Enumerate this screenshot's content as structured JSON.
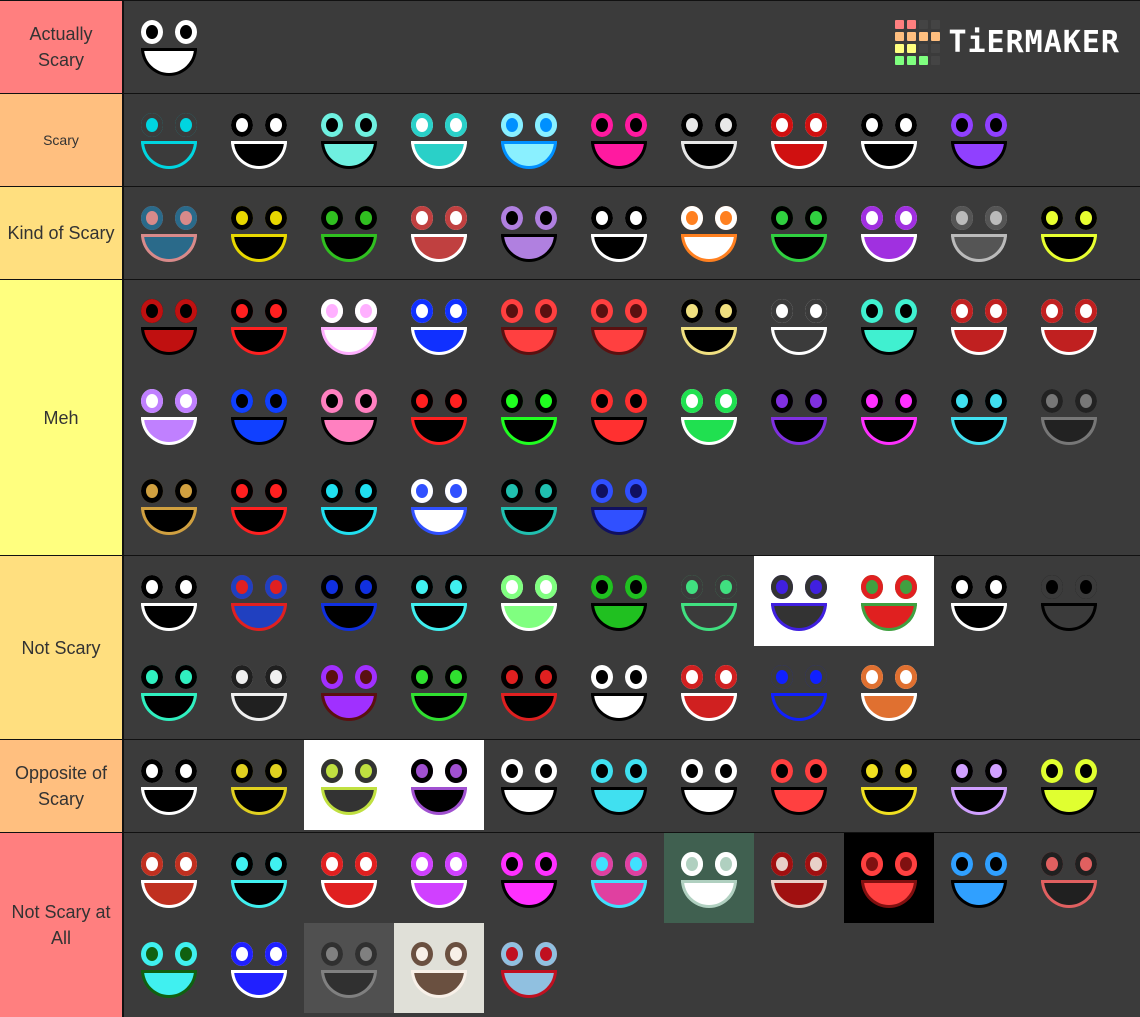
{
  "logo": {
    "text": "TiERMAKER",
    "grid_colors": [
      "#ff7f7f",
      "#ff7f7f",
      "#444444",
      "#444444",
      "#ffbf7f",
      "#ffbf7f",
      "#ffbf7f",
      "#ffbf7f",
      "#ffff7f",
      "#ffff7f",
      "#444444",
      "#444444",
      "#7fff7f",
      "#7fff7f",
      "#7fff7f",
      "#444444"
    ]
  },
  "tiers": [
    {
      "label": "Actually Scary",
      "color": "#ff7f7f",
      "items": [
        {
          "name": "black-figure",
          "bg": "#3b3b3b",
          "fg": "#000000",
          "accent": "#ffffff"
        }
      ]
    },
    {
      "label": "Scary",
      "color": "#ffbf7f",
      "items": [
        {
          "name": "cyan-smile",
          "bg": "#3b3b3b",
          "fg": "#00d5e0",
          "accent": "#3b3b3b"
        },
        {
          "name": "pixel-grin",
          "bg": "#3b3b3b",
          "fg": "#ffffff",
          "accent": "#000000"
        },
        {
          "name": "black-teal-grin",
          "bg": "#3b3b3b",
          "fg": "#000000",
          "accent": "#6ff0e0"
        },
        {
          "name": "teal-eyes-grin",
          "bg": "#3b3b3b",
          "fg": "#ffffff",
          "accent": "#2ad0c8"
        },
        {
          "name": "blue-glow-face",
          "bg": "#3b3b3b",
          "fg": "#0090ff",
          "accent": "#8af0ff"
        },
        {
          "name": "magenta-mouth",
          "bg": "#3b3b3b",
          "fg": "#000000",
          "accent": "#ff1aa0"
        },
        {
          "name": "white-scribble-face",
          "bg": "#3b3b3b",
          "fg": "#e8e8e8",
          "accent": "#000000"
        },
        {
          "name": "red-white-grin",
          "bg": "#3b3b3b",
          "fg": "#ffffff",
          "accent": "#d01010"
        },
        {
          "name": "pixel-grin-2",
          "bg": "#3b3b3b",
          "fg": "#ffffff",
          "accent": "#000000"
        },
        {
          "name": "purple-fang-mouth",
          "bg": "#3b3b3b",
          "fg": "#000000",
          "accent": "#9040ff"
        }
      ]
    },
    {
      "label": "Kind of Scary",
      "color": "#ffdf7f",
      "items": [
        {
          "name": "realistic-eyeball",
          "bg": "#3b3b3b",
          "fg": "#d88a8a",
          "accent": "#2a6a8a"
        },
        {
          "name": "yellow-crescents",
          "bg": "#3b3b3b",
          "fg": "#e8d800",
          "accent": "#000000"
        },
        {
          "name": "green-blades",
          "bg": "#3b3b3b",
          "fg": "#30c020",
          "accent": "#000000"
        },
        {
          "name": "lips-grin",
          "bg": "#3b3b3b",
          "fg": "#ffffff",
          "accent": "#c04040"
        },
        {
          "name": "purple-grin",
          "bg": "#3b3b3b",
          "fg": "#000000",
          "accent": "#b080e0"
        },
        {
          "name": "white-stripes",
          "bg": "#3b3b3b",
          "fg": "#ffffff",
          "accent": "#000000"
        },
        {
          "name": "orange-beak",
          "bg": "#3b3b3b",
          "fg": "#ff8020",
          "accent": "#ffffff"
        },
        {
          "name": "green-frown",
          "bg": "#3b3b3b",
          "fg": "#30d040",
          "accent": "#000000"
        },
        {
          "name": "spiral-eyes",
          "bg": "#3b3b3b",
          "fg": "#ffffff",
          "accent": "#a030e0"
        },
        {
          "name": "gray-ghost",
          "bg": "#3b3b3b",
          "fg": "#bbbbbb",
          "accent": "#555555"
        },
        {
          "name": "yellow-drop",
          "bg": "#3b3b3b",
          "fg": "#e8ff30",
          "accent": "#000000"
        }
      ]
    },
    {
      "label": "Meh",
      "color": "#ffff7f",
      "items": [
        {
          "name": "red-eyes-mossy",
          "bg": "#3b3b3b",
          "fg": "#000000",
          "accent": "#c01010"
        },
        {
          "name": "red-heart-mouth",
          "bg": "#3b3b3b",
          "fg": "#ff2020",
          "accent": "#000000"
        },
        {
          "name": "pink-eyes",
          "bg": "#3b3b3b",
          "fg": "#ffb0ff",
          "accent": "#ffffff"
        },
        {
          "name": "blue-outline-eyes",
          "bg": "#3b3b3b",
          "fg": "#ffffff",
          "accent": "#1030ff"
        },
        {
          "name": "red-shadow-face",
          "bg": "#3b3b3b",
          "fg": "#5a1010",
          "accent": "#ff4040"
        },
        {
          "name": "red-shadow-face-2",
          "bg": "#3b3b3b",
          "fg": "#5a1010",
          "accent": "#ff4040"
        },
        {
          "name": "yellow-mushroom",
          "bg": "#3b3b3b",
          "fg": "#f0e080",
          "accent": "#000000"
        },
        {
          "name": "white-scribble-smile",
          "bg": "#3b3b3b",
          "fg": "#ffffff",
          "accent": "#3b3b3b"
        },
        {
          "name": "teal-eye-grin",
          "bg": "#3b3b3b",
          "fg": "#000000",
          "accent": "#40f0d0"
        },
        {
          "name": "red-gum-smile",
          "bg": "#3b3b3b",
          "fg": "#ffffff",
          "accent": "#c02020"
        },
        {
          "name": "cyclops-grin",
          "bg": "#3b3b3b",
          "fg": "#ffffff",
          "accent": "#c02020"
        },
        {
          "name": "purple-eyes-frown",
          "bg": "#3b3b3b",
          "fg": "#ffffff",
          "accent": "#c080ff"
        },
        {
          "name": "blue-glint-grin",
          "bg": "#3b3b3b",
          "fg": "#000000",
          "accent": "#1040ff"
        },
        {
          "name": "pink-tongue",
          "bg": "#3b3b3b",
          "fg": "#000000",
          "accent": "#ff80c0"
        },
        {
          "name": "red-skull",
          "bg": "#3b3b3b",
          "fg": "#ff2020",
          "accent": "#000000"
        },
        {
          "name": "green-blocks",
          "bg": "#3b3b3b",
          "fg": "#20ff20",
          "accent": "#000000"
        },
        {
          "name": "red-glow-grin",
          "bg": "#3b3b3b",
          "fg": "#000000",
          "accent": "#ff3030"
        },
        {
          "name": "green-frown-blob",
          "bg": "#3b3b3b",
          "fg": "#ffffff",
          "accent": "#20e050"
        },
        {
          "name": "purple-ring-eyes",
          "bg": "#3b3b3b",
          "fg": "#8030e0",
          "accent": "#000000"
        },
        {
          "name": "magenta-eyes-grin",
          "bg": "#3b3b3b",
          "fg": "#ff30ff",
          "accent": "#000000"
        },
        {
          "name": "cyan-frown",
          "bg": "#3b3b3b",
          "fg": "#40e0f0",
          "accent": "#000000"
        },
        {
          "name": "glitch-static",
          "bg": "#3b3b3b",
          "fg": "#777777",
          "accent": "#222222"
        },
        {
          "name": "gold-ring-eyes",
          "bg": "#3b3b3b",
          "fg": "#d0a040",
          "accent": "#000000"
        },
        {
          "name": "red-pixel-face",
          "bg": "#3b3b3b",
          "fg": "#ff2020",
          "accent": "#000000"
        },
        {
          "name": "cyan-pixel-face",
          "bg": "#3b3b3b",
          "fg": "#20e0f0",
          "accent": "#000000"
        },
        {
          "name": "blue-slash",
          "bg": "#3b3b3b",
          "fg": "#3050ff",
          "accent": "#ffffff"
        },
        {
          "name": "teal-tree",
          "bg": "#3b3b3b",
          "fg": "#20c0b0",
          "accent": "#000000"
        },
        {
          "name": "dark-blue-face",
          "bg": "#3b3b3b",
          "fg": "#101060",
          "accent": "#3050ff"
        }
      ]
    },
    {
      "label": "Not Scary",
      "color": "#ffdf7f",
      "items": [
        {
          "name": "trollface",
          "bg": "#3b3b3b",
          "fg": "#ffffff",
          "accent": "#000000"
        },
        {
          "name": "mario",
          "bg": "#3b3b3b",
          "fg": "#e02020",
          "accent": "#2040c0"
        },
        {
          "name": "blue-frown-eyes",
          "bg": "#3b3b3b",
          "fg": "#1030e0",
          "accent": "#000000"
        },
        {
          "name": "cyan-mouth-eyes",
          "bg": "#3b3b3b",
          "fg": "#40f0f0",
          "accent": "#000000"
        },
        {
          "name": "green-white-eyes",
          "bg": "#3b3b3b",
          "fg": "#ffffff",
          "accent": "#80ff80"
        },
        {
          "name": "dark-green-eyes",
          "bg": "#3b3b3b",
          "fg": "#000000",
          "accent": "#20c020"
        },
        {
          "name": "green-lips",
          "bg": "#3b3b3b",
          "fg": "#40e080",
          "accent": "#3b3b3b"
        },
        {
          "name": "scribble-blue-mouth",
          "bg": "#ffffff",
          "fg": "#4020e0",
          "accent": "#333333"
        },
        {
          "name": "scribble-green-grin",
          "bg": "#ffffff",
          "fg": "#40a040",
          "accent": "#e02020"
        },
        {
          "name": "white-eyes-mask",
          "bg": "#3b3b3b",
          "fg": "#ffffff",
          "accent": "#000000"
        },
        {
          "name": "sad-outline-face",
          "bg": "#3b3b3b",
          "fg": "#000000",
          "accent": "#3b3b3b"
        },
        {
          "name": "teal-v-face",
          "bg": "#3b3b3b",
          "fg": "#30f0c0",
          "accent": "#000000"
        },
        {
          "name": "eyeball-cluster",
          "bg": "#3b3b3b",
          "fg": "#f0f0f0",
          "accent": "#202020"
        },
        {
          "name": "purple-bandage",
          "bg": "#3b3b3b",
          "fg": "#5a1010",
          "accent": "#a030ff"
        },
        {
          "name": "green-eyes-smile",
          "bg": "#3b3b3b",
          "fg": "#30e030",
          "accent": "#000000"
        },
        {
          "name": "red-eye-grin",
          "bg": "#3b3b3b",
          "fg": "#e02020",
          "accent": "#000000"
        },
        {
          "name": "black-eyes-teeth",
          "bg": "#3b3b3b",
          "fg": "#000000",
          "accent": "#ffffff"
        },
        {
          "name": "red-white-eyes-grin",
          "bg": "#3b3b3b",
          "fg": "#ffffff",
          "accent": "#d02020"
        },
        {
          "name": "blue-smile",
          "bg": "#3b3b3b",
          "fg": "#1020ff",
          "accent": "#3b3b3b"
        },
        {
          "name": "orange-egg",
          "bg": "#3b3b3b",
          "fg": "#ffffff",
          "accent": "#e07030"
        }
      ]
    },
    {
      "label": "Opposite of Scary",
      "color": "#ffbf7f",
      "items": [
        {
          "name": "trollface-2",
          "bg": "#3b3b3b",
          "fg": "#ffffff",
          "accent": "#000000"
        },
        {
          "name": "yellow-smirk",
          "bg": "#3b3b3b",
          "fg": "#e0d020",
          "accent": "#000000"
        },
        {
          "name": "scribble-yellow-mouth",
          "bg": "#ffffff",
          "fg": "#c0e040",
          "accent": "#333333"
        },
        {
          "name": "purple-ghost-grin",
          "bg": "#ffffff",
          "fg": "#a050d0",
          "accent": "#000000"
        },
        {
          "name": "blue-eye-grin",
          "bg": "#3b3b3b",
          "fg": "#000000",
          "accent": "#ffffff"
        },
        {
          "name": "cyan-frown-eyes",
          "bg": "#3b3b3b",
          "fg": "#000000",
          "accent": "#40e0f0"
        },
        {
          "name": "purple-tooth-grin",
          "bg": "#3b3b3b",
          "fg": "#000000",
          "accent": "#ffffff"
        },
        {
          "name": "red-eye-smile",
          "bg": "#3b3b3b",
          "fg": "#000000",
          "accent": "#ff4040"
        },
        {
          "name": "yellow-beak",
          "bg": "#3b3b3b",
          "fg": "#f0e020",
          "accent": "#000000"
        },
        {
          "name": "lavender-blob",
          "bg": "#3b3b3b",
          "fg": "#d0a0ff",
          "accent": "#000000"
        },
        {
          "name": "green-slits",
          "bg": "#3b3b3b",
          "fg": "#000000",
          "accent": "#e0ff30"
        }
      ]
    },
    {
      "label": "Not Scary at All",
      "color": "#ff7f7f",
      "items": [
        {
          "name": "red-lip-grin",
          "bg": "#3b3b3b",
          "fg": "#ffffff",
          "accent": "#c03020"
        },
        {
          "name": "cyan-v-mouth",
          "bg": "#3b3b3b",
          "fg": "#40f0f0",
          "accent": "#000000"
        },
        {
          "name": "red-tongue-face",
          "bg": "#3b3b3b",
          "fg": "#ffffff",
          "accent": "#e02020"
        },
        {
          "name": "glitch-eyes",
          "bg": "#3b3b3b",
          "fg": "#ffffff",
          "accent": "#d040ff"
        },
        {
          "name": "rainbow-smile",
          "bg": "#3b3b3b",
          "fg": "#000000",
          "accent": "#ff30ff"
        },
        {
          "name": "cyan-mask",
          "bg": "#3b3b3b",
          "fg": "#40e0ff",
          "accent": "#e040a0"
        },
        {
          "name": "creepy-photo-grin",
          "bg": "#406050",
          "fg": "#b0d0c0",
          "accent": "#ffffff"
        },
        {
          "name": "pale-face-photo",
          "bg": "#3b3b3b",
          "fg": "#e8d0c8",
          "accent": "#a01010"
        },
        {
          "name": "dark-red-photo",
          "bg": "#000000",
          "fg": "#801010",
          "accent": "#ff4040"
        },
        {
          "name": "x-eyes-rainbow-mouth",
          "bg": "#3b3b3b",
          "fg": "#000000",
          "accent": "#30a0ff"
        },
        {
          "name": "bloodshot-eyes",
          "bg": "#3b3b3b",
          "fg": "#e06060",
          "accent": "#202020"
        },
        {
          "name": "green-x-eyes",
          "bg": "#3b3b3b",
          "fg": "#106010",
          "accent": "#40f0f0"
        },
        {
          "name": "rainbow-swirl-face",
          "bg": "#3b3b3b",
          "fg": "#ffffff",
          "accent": "#2020ff"
        },
        {
          "name": "gray-kitten",
          "bg": "#505050",
          "fg": "#808080",
          "accent": "#303030"
        },
        {
          "name": "white-kitten",
          "bg": "#e0e0d8",
          "fg": "#f8f0e8",
          "accent": "#6a5040"
        },
        {
          "name": "among-us-crewmate",
          "bg": "#3b3b3b",
          "fg": "#c01020",
          "accent": "#90c0e0"
        }
      ]
    }
  ]
}
